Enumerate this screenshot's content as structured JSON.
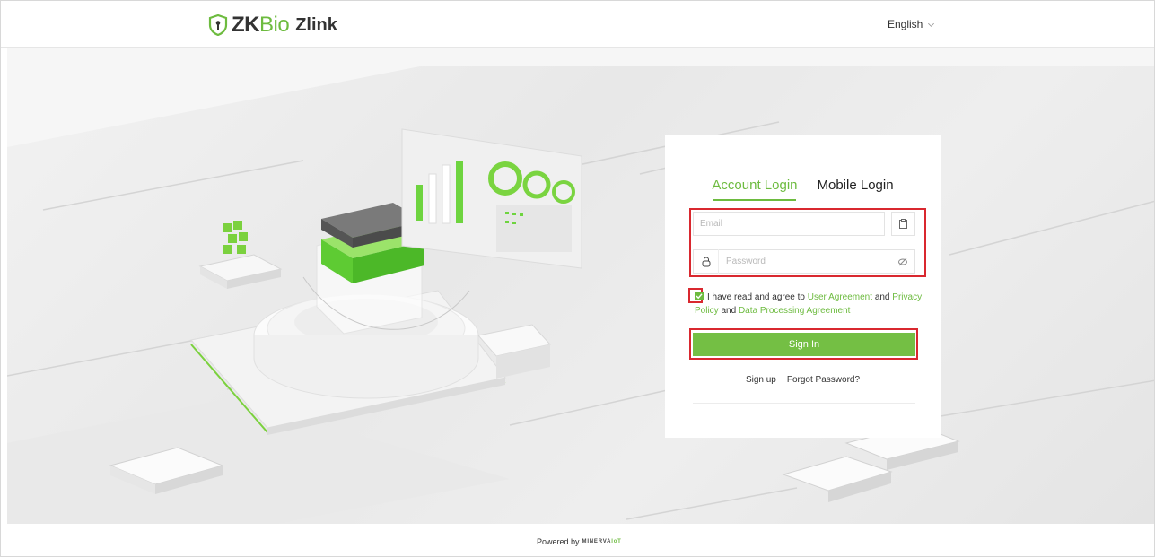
{
  "header": {
    "logo_zk": "ZK",
    "logo_bio": "Bio",
    "logo_zlink": "Zlink",
    "language": "English"
  },
  "login": {
    "tabs": [
      {
        "label": "Account Login",
        "active": true
      },
      {
        "label": "Mobile Login",
        "active": false
      }
    ],
    "email_placeholder": "Email",
    "password_placeholder": "Password",
    "agreement": {
      "checked": true,
      "prefix": "I have read and agree to",
      "user_agreement": "User Agreement",
      "and1": "and",
      "privacy_policy": "Privacy Policy",
      "and2": "and",
      "data_processing": "Data Processing Agreement"
    },
    "sign_in": "Sign In",
    "sign_up": "Sign up",
    "forgot_password": "Forgot Password?"
  },
  "footer": {
    "powered_by": "Powered by",
    "brand_a": "MINERVA",
    "brand_b": "IoT"
  },
  "colors": {
    "accent": "#6dbb3f",
    "highlight_box": "#d9282f"
  },
  "icons": [
    "shield-logo-icon",
    "chevron-down-icon",
    "clipboard-icon",
    "lock-icon",
    "eye-slash-icon",
    "checkmark-icon"
  ]
}
